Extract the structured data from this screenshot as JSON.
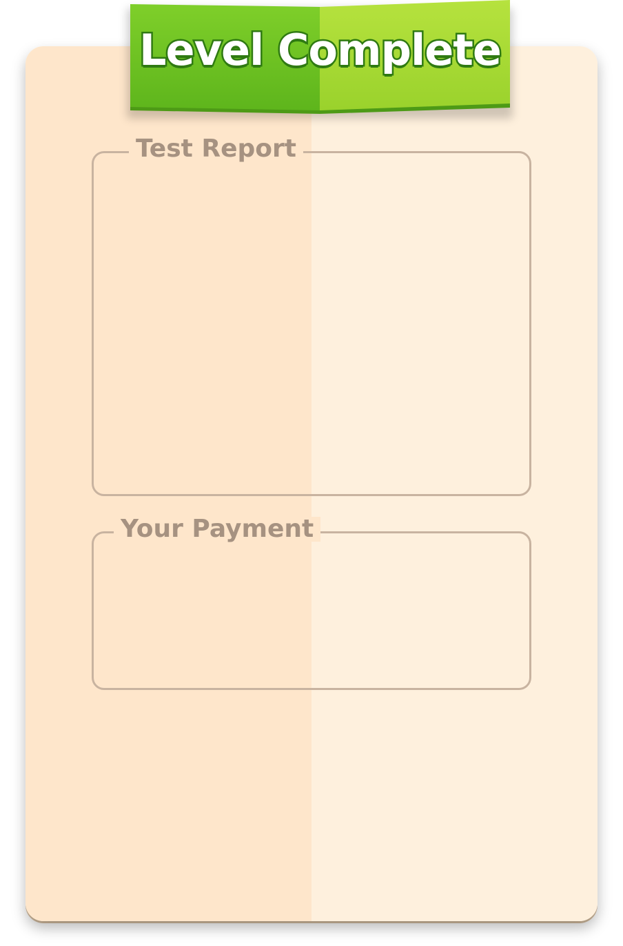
{
  "banner": {
    "title": "Level Complete"
  },
  "sections": {
    "test_report": {
      "label": "Test Report"
    },
    "your_payment": {
      "label": "Your Payment"
    }
  },
  "colors": {
    "card_left": "#fee6cb",
    "card_right": "#fef0dd",
    "panel_border": "#c8b3a0",
    "label_text": "#a69281",
    "ribbon_green_dark": "#6cc11f",
    "ribbon_green_light": "#abdc36",
    "ribbon_outline": "#2f7a12"
  }
}
